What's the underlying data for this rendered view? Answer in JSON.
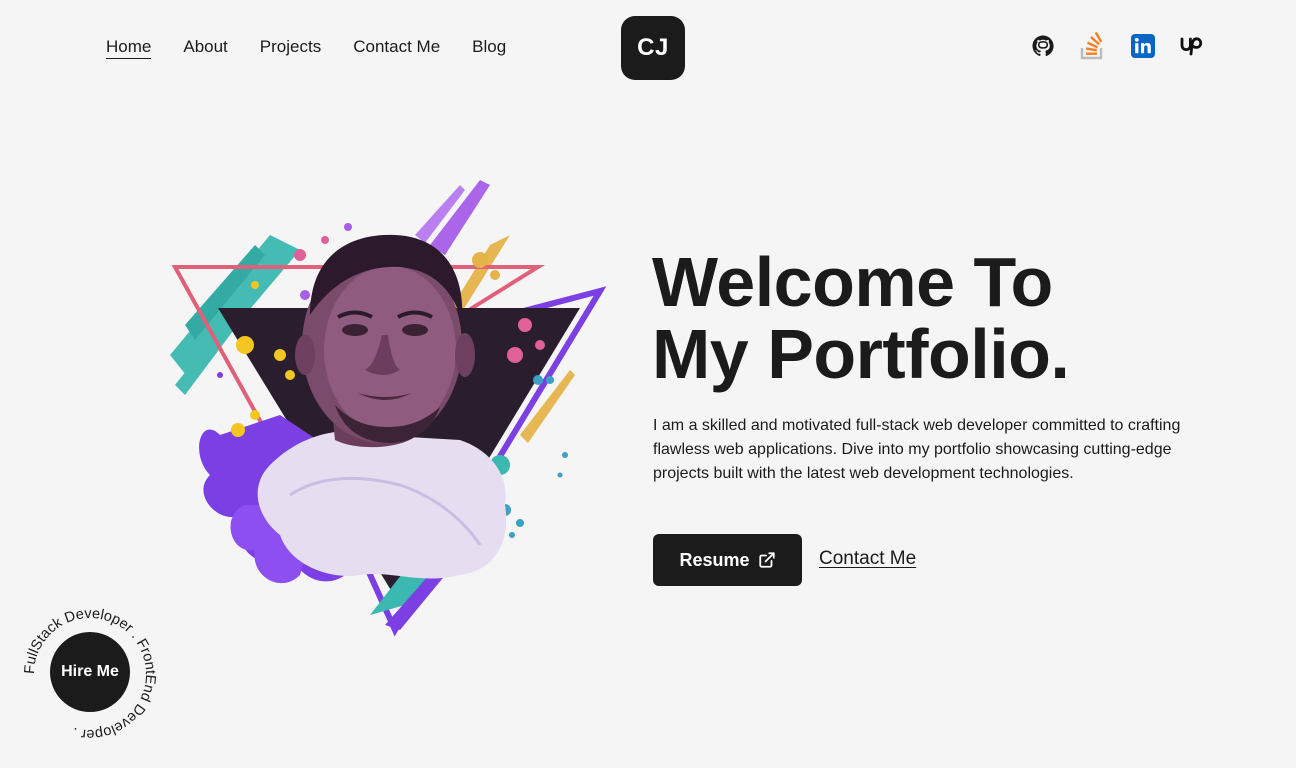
{
  "nav": {
    "items": [
      {
        "label": "Home",
        "active": true
      },
      {
        "label": "About",
        "active": false
      },
      {
        "label": "Projects",
        "active": false
      },
      {
        "label": "Contact Me",
        "active": false
      },
      {
        "label": "Blog",
        "active": false
      }
    ]
  },
  "logo": {
    "text": "CJ"
  },
  "socials": [
    {
      "name": "github-icon"
    },
    {
      "name": "stackoverflow-icon"
    },
    {
      "name": "linkedin-icon"
    },
    {
      "name": "upwork-icon"
    }
  ],
  "hero": {
    "title_line1": "Welcome To",
    "title_line2": "My Portfolio.",
    "description": "I am a skilled and motivated full-stack web developer committed to crafting flawless web applications. Dive into my portfolio showcasing cutting-edge projects built with the latest web development technologies.",
    "resume_label": "Resume",
    "contact_label": "Contact Me"
  },
  "hire": {
    "label": "Hire Me",
    "ring_text": "FullStack Developer . FrontEnd Developer ."
  },
  "colors": {
    "background": "#f5f5f5",
    "dark": "#1b1b1b",
    "purple": "#7b3fe4",
    "teal": "#3bb8b0",
    "pink": "#e0609a",
    "yellow": "#f3c622"
  }
}
